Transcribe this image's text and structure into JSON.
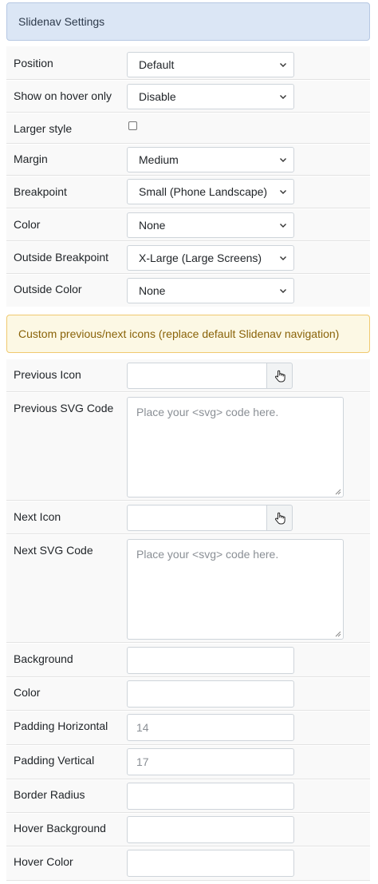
{
  "header": {
    "title": "Slidenav Settings"
  },
  "fields": {
    "position": {
      "label": "Position",
      "value": "Default"
    },
    "show_on_hover": {
      "label": "Show on hover only",
      "value": "Disable"
    },
    "larger_style": {
      "label": "Larger style",
      "checked": false
    },
    "margin": {
      "label": "Margin",
      "value": "Medium"
    },
    "breakpoint": {
      "label": "Breakpoint",
      "value": "Small (Phone Landscape)"
    },
    "color": {
      "label": "Color",
      "value": "None"
    },
    "outside_breakpoint": {
      "label": "Outside Breakpoint",
      "value": "X-Large (Large Screens)"
    },
    "outside_color": {
      "label": "Outside Color",
      "value": "None"
    }
  },
  "notice": {
    "text": "Custom previous/next icons (replace default Slidenav navigation)"
  },
  "icons": {
    "previous_icon": {
      "label": "Previous Icon",
      "value": ""
    },
    "previous_svg": {
      "label": "Previous SVG Code",
      "placeholder": "Place your <svg> code here."
    },
    "next_icon": {
      "label": "Next Icon",
      "value": ""
    },
    "next_svg": {
      "label": "Next SVG Code",
      "placeholder": "Place your <svg> code here."
    }
  },
  "style": {
    "background": {
      "label": "Background",
      "value": ""
    },
    "color": {
      "label": "Color",
      "value": ""
    },
    "padding_horizontal": {
      "label": "Padding Horizontal",
      "placeholder": "14"
    },
    "padding_vertical": {
      "label": "Padding Vertical",
      "placeholder": "17"
    },
    "border_radius": {
      "label": "Border Radius",
      "value": ""
    },
    "hover_background": {
      "label": "Hover Background",
      "value": ""
    },
    "hover_color": {
      "label": "Hover Color",
      "value": ""
    }
  }
}
